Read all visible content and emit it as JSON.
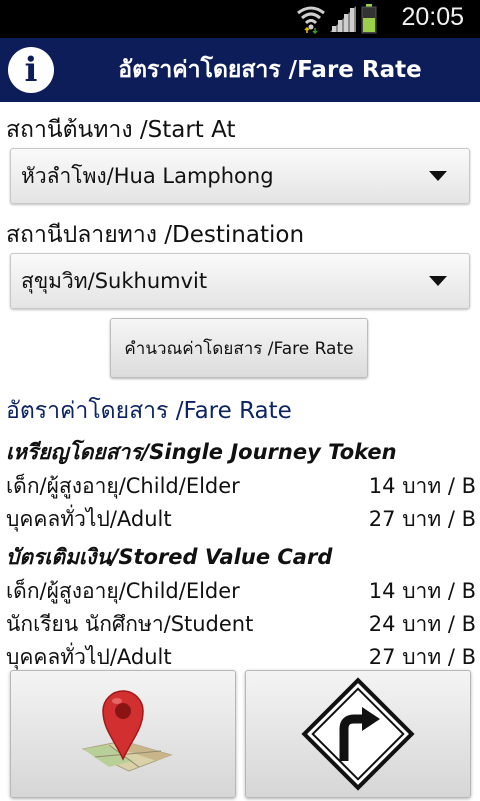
{
  "status_bar": {
    "time": "20:05",
    "icons": [
      "wifi-icon",
      "signal-icon",
      "battery-icon"
    ]
  },
  "header": {
    "title": "อัตราค่าโดยสาร /Fare Rate",
    "info_icon": "info-icon",
    "info_glyph": "i",
    "color": "#0c1d5a"
  },
  "form": {
    "start_label": "สถานีต้นทาง /Start At",
    "start_value": "หัวลำโพง/Hua Lamphong",
    "destination_label": "สถานีปลายทาง /Destination",
    "destination_value": "สุขุมวิท/Sukhumvit",
    "calculate_button": "คำนวณค่าโดยสาร /Fare Rate"
  },
  "results": {
    "title": "อัตราค่าโดยสาร /Fare Rate",
    "sections": [
      {
        "title": "เหรียญโดยสาร/Single Journey Token",
        "rows": [
          {
            "label": "เด็ก/ผู้สูงอายุ/Child/Elder",
            "amount": "14 บาท / B"
          },
          {
            "label": "บุคคลทั่วไป/Adult",
            "amount": "27 บาท / B"
          }
        ]
      },
      {
        "title": "บัตรเติมเงิน/Stored Value Card",
        "rows": [
          {
            "label": "เด็ก/ผู้สูงอายุ/Child/Elder",
            "amount": "14 บาท / B"
          },
          {
            "label": "นักเรียน นักศึกษา/Student",
            "amount": "24 บาท / B"
          },
          {
            "label": "บุคคลทั่วไป/Adult",
            "amount": "27 บาท / B"
          }
        ]
      }
    ]
  },
  "bottom_buttons": [
    {
      "icon": "map-pin-icon"
    },
    {
      "icon": "turn-right-sign-icon"
    }
  ]
}
